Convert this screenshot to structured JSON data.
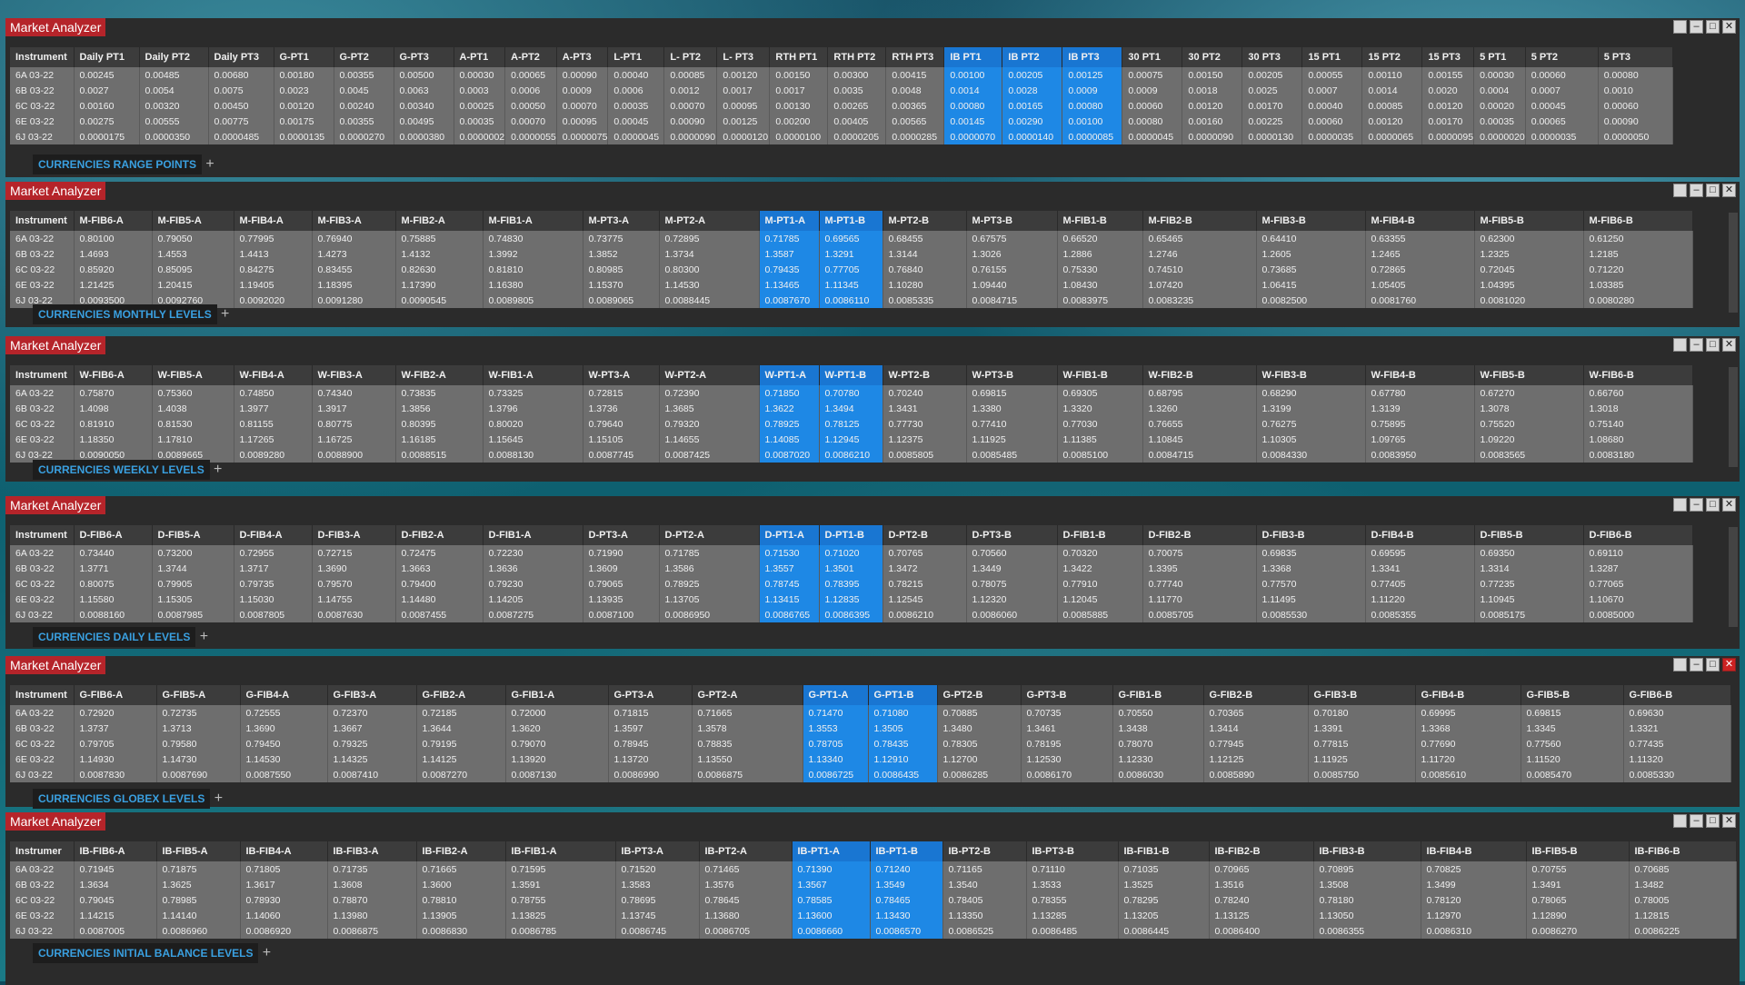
{
  "colors": {
    "title_bg": "#b5242a",
    "highlight": "#1e88e5",
    "tab_text": "#3aa0e0",
    "cell_bg": "#6e6e6e"
  },
  "panels": [
    {
      "title": "Market Analyzer",
      "tab": "CURRENCIES RANGE POINTS",
      "headers": [
        "Instrument",
        "Daily PT1",
        "Daily PT2",
        "Daily PT3",
        "G-PT1",
        "G-PT2",
        "G-PT3",
        "A-PT1",
        "A-PT2",
        "A-PT3",
        "L-PT1",
        "L- PT2",
        "L- PT3",
        "RTH PT1",
        "RTH PT2",
        "RTH PT3",
        "IB PT1",
        "IB PT2",
        "IB PT3",
        "30 PT1",
        "30 PT2",
        "30 PT3",
        "15 PT1",
        "15 PT2",
        "15 PT3",
        "5 PT1",
        "5 PT2",
        "5 PT3"
      ],
      "rows": [
        [
          "6A 03-22",
          "0.00245",
          "0.00485",
          "0.00680",
          "0.00180",
          "0.00355",
          "0.00500",
          "0.00030",
          "0.00065",
          "0.00090",
          "0.00040",
          "0.00085",
          "0.00120",
          "0.00150",
          "0.00300",
          "0.00415",
          "0.00100",
          "0.00205",
          "0.00125",
          "0.00075",
          "0.00150",
          "0.00205",
          "0.00055",
          "0.00110",
          "0.00155",
          "0.00030",
          "0.00060",
          "0.00080"
        ],
        [
          "6B 03-22",
          "0.0027",
          "0.0054",
          "0.0075",
          "0.0023",
          "0.0045",
          "0.0063",
          "0.0003",
          "0.0006",
          "0.0009",
          "0.0006",
          "0.0012",
          "0.0017",
          "0.0017",
          "0.0035",
          "0.0048",
          "0.0014",
          "0.0028",
          "0.0009",
          "0.0009",
          "0.0018",
          "0.0025",
          "0.0007",
          "0.0014",
          "0.0020",
          "0.0004",
          "0.0007",
          "0.0010"
        ],
        [
          "6C 03-22",
          "0.00160",
          "0.00320",
          "0.00450",
          "0.00120",
          "0.00240",
          "0.00340",
          "0.00025",
          "0.00050",
          "0.00070",
          "0.00035",
          "0.00070",
          "0.00095",
          "0.00130",
          "0.00265",
          "0.00365",
          "0.00080",
          "0.00165",
          "0.00080",
          "0.00060",
          "0.00120",
          "0.00170",
          "0.00040",
          "0.00085",
          "0.00120",
          "0.00020",
          "0.00045",
          "0.00060"
        ],
        [
          "6E 03-22",
          "0.00275",
          "0.00555",
          "0.00775",
          "0.00175",
          "0.00355",
          "0.00495",
          "0.00035",
          "0.00070",
          "0.00095",
          "0.00045",
          "0.00090",
          "0.00125",
          "0.00200",
          "0.00405",
          "0.00565",
          "0.00145",
          "0.00290",
          "0.00100",
          "0.00080",
          "0.00160",
          "0.00225",
          "0.00060",
          "0.00120",
          "0.00170",
          "0.00035",
          "0.00065",
          "0.00090"
        ],
        [
          "6J 03-22",
          "0.0000175",
          "0.0000350",
          "0.0000485",
          "0.0000135",
          "0.0000270",
          "0.0000380",
          "0.0000002",
          "0.0000055",
          "0.0000075",
          "0.0000045",
          "0.0000090",
          "0.0000120",
          "0.0000100",
          "0.0000205",
          "0.0000285",
          "0.0000070",
          "0.0000140",
          "0.0000085",
          "0.0000045",
          "0.0000090",
          "0.0000130",
          "0.0000035",
          "0.0000065",
          "0.0000095",
          "0.0000020",
          "0.0000035",
          "0.0000050"
        ]
      ]
    },
    {
      "title": "Market Analyzer",
      "tab": "CURRENCIES MONTHLY LEVELS",
      "headers": [
        "Instrument",
        "M-FIB6-A",
        "M-FIB5-A",
        "M-FIB4-A",
        "M-FIB3-A",
        "M-FIB2-A",
        "M-FIB1-A",
        "M-PT3-A",
        "M-PT2-A",
        "M-PT1-A",
        "M-PT1-B",
        "M-PT2-B",
        "M-PT3-B",
        "M-FIB1-B",
        "M-FIB2-B",
        "M-FIB3-B",
        "M-FIB4-B",
        "M-FIB5-B",
        "M-FIB6-B"
      ],
      "rows": [
        [
          "6A 03-22",
          "0.80100",
          "0.79050",
          "0.77995",
          "0.76940",
          "0.75885",
          "0.74830",
          "0.73775",
          "0.72895",
          "0.71785",
          "0.69565",
          "0.68455",
          "0.67575",
          "0.66520",
          "0.65465",
          "0.64410",
          "0.63355",
          "0.62300",
          "0.61250"
        ],
        [
          "6B 03-22",
          "1.4693",
          "1.4553",
          "1.4413",
          "1.4273",
          "1.4132",
          "1.3992",
          "1.3852",
          "1.3734",
          "1.3587",
          "1.3291",
          "1.3144",
          "1.3026",
          "1.2886",
          "1.2746",
          "1.2605",
          "1.2465",
          "1.2325",
          "1.2185"
        ],
        [
          "6C 03-22",
          "0.85920",
          "0.85095",
          "0.84275",
          "0.83455",
          "0.82630",
          "0.81810",
          "0.80985",
          "0.80300",
          "0.79435",
          "0.77705",
          "0.76840",
          "0.76155",
          "0.75330",
          "0.74510",
          "0.73685",
          "0.72865",
          "0.72045",
          "0.71220"
        ],
        [
          "6E 03-22",
          "1.21425",
          "1.20415",
          "1.19405",
          "1.18395",
          "1.17390",
          "1.16380",
          "1.15370",
          "1.14530",
          "1.13465",
          "1.11345",
          "1.10280",
          "1.09440",
          "1.08430",
          "1.07420",
          "1.06415",
          "1.05405",
          "1.04395",
          "1.03385"
        ],
        [
          "6J 03-22",
          "0.0093500",
          "0.0092760",
          "0.0092020",
          "0.0091280",
          "0.0090545",
          "0.0089805",
          "0.0089065",
          "0.0088445",
          "0.0087670",
          "0.0086110",
          "0.0085335",
          "0.0084715",
          "0.0083975",
          "0.0083235",
          "0.0082500",
          "0.0081760",
          "0.0081020",
          "0.0080280"
        ]
      ]
    },
    {
      "title": "Market Analyzer",
      "tab": "CURRENCIES WEEKLY LEVELS",
      "headers": [
        "Instrument",
        "W-FIB6-A",
        "W-FIB5-A",
        "W-FIB4-A",
        "W-FIB3-A",
        "W-FIB2-A",
        "W-FIB1-A",
        "W-PT3-A",
        "W-PT2-A",
        "W-PT1-A",
        "W-PT1-B",
        "W-PT2-B",
        "W-PT3-B",
        "W-FIB1-B",
        "W-FIB2-B",
        "W-FIB3-B",
        "W-FIB4-B",
        "W-FIB5-B",
        "W-FIB6-B"
      ],
      "rows": [
        [
          "6A 03-22",
          "0.75870",
          "0.75360",
          "0.74850",
          "0.74340",
          "0.73835",
          "0.73325",
          "0.72815",
          "0.72390",
          "0.71850",
          "0.70780",
          "0.70240",
          "0.69815",
          "0.69305",
          "0.68795",
          "0.68290",
          "0.67780",
          "0.67270",
          "0.66760"
        ],
        [
          "6B 03-22",
          "1.4098",
          "1.4038",
          "1.3977",
          "1.3917",
          "1.3856",
          "1.3796",
          "1.3736",
          "1.3685",
          "1.3622",
          "1.3494",
          "1.3431",
          "1.3380",
          "1.3320",
          "1.3260",
          "1.3199",
          "1.3139",
          "1.3078",
          "1.3018"
        ],
        [
          "6C 03-22",
          "0.81910",
          "0.81530",
          "0.81155",
          "0.80775",
          "0.80395",
          "0.80020",
          "0.79640",
          "0.79320",
          "0.78925",
          "0.78125",
          "0.77730",
          "0.77410",
          "0.77030",
          "0.76655",
          "0.76275",
          "0.75895",
          "0.75520",
          "0.75140"
        ],
        [
          "6E 03-22",
          "1.18350",
          "1.17810",
          "1.17265",
          "1.16725",
          "1.16185",
          "1.15645",
          "1.15105",
          "1.14655",
          "1.14085",
          "1.12945",
          "1.12375",
          "1.11925",
          "1.11385",
          "1.10845",
          "1.10305",
          "1.09765",
          "1.09220",
          "1.08680"
        ],
        [
          "6J 03-22",
          "0.0090050",
          "0.0089665",
          "0.0089280",
          "0.0088900",
          "0.0088515",
          "0.0088130",
          "0.0087745",
          "0.0087425",
          "0.0087020",
          "0.0086210",
          "0.0085805",
          "0.0085485",
          "0.0085100",
          "0.0084715",
          "0.0084330",
          "0.0083950",
          "0.0083565",
          "0.0083180"
        ]
      ]
    },
    {
      "title": "Market Analyzer",
      "tab": "CURRENCIES DAILY LEVELS",
      "headers": [
        "Instrument",
        "D-FIB6-A",
        "D-FIB5-A",
        "D-FIB4-A",
        "D-FIB3-A",
        "D-FIB2-A",
        "D-FIB1-A",
        "D-PT3-A",
        "D-PT2-A",
        "D-PT1-A",
        "D-PT1-B",
        "D-PT2-B",
        "D-PT3-B",
        "D-FIB1-B",
        "D-FIB2-B",
        "D-FIB3-B",
        "D-FIB4-B",
        "D-FIB5-B",
        "D-FIB6-B"
      ],
      "rows": [
        [
          "6A 03-22",
          "0.73440",
          "0.73200",
          "0.72955",
          "0.72715",
          "0.72475",
          "0.72230",
          "0.71990",
          "0.71785",
          "0.71530",
          "0.71020",
          "0.70765",
          "0.70560",
          "0.70320",
          "0.70075",
          "0.69835",
          "0.69595",
          "0.69350",
          "0.69110"
        ],
        [
          "6B 03-22",
          "1.3771",
          "1.3744",
          "1.3717",
          "1.3690",
          "1.3663",
          "1.3636",
          "1.3609",
          "1.3586",
          "1.3557",
          "1.3501",
          "1.3472",
          "1.3449",
          "1.3422",
          "1.3395",
          "1.3368",
          "1.3341",
          "1.3314",
          "1.3287"
        ],
        [
          "6C 03-22",
          "0.80075",
          "0.79905",
          "0.79735",
          "0.79570",
          "0.79400",
          "0.79230",
          "0.79065",
          "0.78925",
          "0.78745",
          "0.78395",
          "0.78215",
          "0.78075",
          "0.77910",
          "0.77740",
          "0.77570",
          "0.77405",
          "0.77235",
          "0.77065"
        ],
        [
          "6E 03-22",
          "1.15580",
          "1.15305",
          "1.15030",
          "1.14755",
          "1.14480",
          "1.14205",
          "1.13935",
          "1.13705",
          "1.13415",
          "1.12835",
          "1.12545",
          "1.12320",
          "1.12045",
          "1.11770",
          "1.11495",
          "1.11220",
          "1.10945",
          "1.10670"
        ],
        [
          "6J 03-22",
          "0.0088160",
          "0.0087985",
          "0.0087805",
          "0.0087630",
          "0.0087455",
          "0.0087275",
          "0.0087100",
          "0.0086950",
          "0.0086765",
          "0.0086395",
          "0.0086210",
          "0.0086060",
          "0.0085885",
          "0.0085705",
          "0.0085530",
          "0.0085355",
          "0.0085175",
          "0.0085000"
        ]
      ]
    },
    {
      "title": "Market Analyzer",
      "tab": "CURRENCIES GLOBEX LEVELS",
      "headers": [
        "Instrument",
        "G-FIB6-A",
        "G-FIB5-A",
        "G-FIB4-A",
        "G-FIB3-A",
        "G-FIB2-A",
        "G-FIB1-A",
        "G-PT3-A",
        "G-PT2-A",
        "G-PT1-A",
        "G-PT1-B",
        "G-PT2-B",
        "G-PT3-B",
        "G-FIB1-B",
        "G-FIB2-B",
        "G-FIB3-B",
        "G-FIB4-B",
        "G-FIB5-B",
        "G-FIB6-B"
      ],
      "rows": [
        [
          "6A 03-22",
          "0.72920",
          "0.72735",
          "0.72555",
          "0.72370",
          "0.72185",
          "0.72000",
          "0.71815",
          "0.71665",
          "0.71470",
          "0.71080",
          "0.70885",
          "0.70735",
          "0.70550",
          "0.70365",
          "0.70180",
          "0.69995",
          "0.69815",
          "0.69630"
        ],
        [
          "6B 03-22",
          "1.3737",
          "1.3713",
          "1.3690",
          "1.3667",
          "1.3644",
          "1.3620",
          "1.3597",
          "1.3578",
          "1.3553",
          "1.3505",
          "1.3480",
          "1.3461",
          "1.3438",
          "1.3414",
          "1.3391",
          "1.3368",
          "1.3345",
          "1.3321"
        ],
        [
          "6C 03-22",
          "0.79705",
          "0.79580",
          "0.79450",
          "0.79325",
          "0.79195",
          "0.79070",
          "0.78945",
          "0.78835",
          "0.78705",
          "0.78435",
          "0.78305",
          "0.78195",
          "0.78070",
          "0.77945",
          "0.77815",
          "0.77690",
          "0.77560",
          "0.77435"
        ],
        [
          "6E 03-22",
          "1.14930",
          "1.14730",
          "1.14530",
          "1.14325",
          "1.14125",
          "1.13920",
          "1.13720",
          "1.13550",
          "1.13340",
          "1.12910",
          "1.12700",
          "1.12530",
          "1.12330",
          "1.12125",
          "1.11925",
          "1.11720",
          "1.11520",
          "1.11320"
        ],
        [
          "6J 03-22",
          "0.0087830",
          "0.0087690",
          "0.0087550",
          "0.0087410",
          "0.0087270",
          "0.0087130",
          "0.0086990",
          "0.0086875",
          "0.0086725",
          "0.0086435",
          "0.0086285",
          "0.0086170",
          "0.0086030",
          "0.0085890",
          "0.0085750",
          "0.0085610",
          "0.0085470",
          "0.0085330"
        ]
      ]
    },
    {
      "title": "Market Analyzer",
      "tab": "CURRENCIES INITIAL BALANCE LEVELS",
      "headers": [
        "Instrumer",
        "IB-FIB6-A",
        "IB-FIB5-A",
        "IB-FIB4-A",
        "IB-FIB3-A",
        "IB-FIB2-A",
        "IB-FIB1-A",
        "IB-PT3-A",
        "IB-PT2-A",
        "IB-PT1-A",
        "IB-PT1-B",
        "IB-PT2-B",
        "IB-PT3-B",
        "IB-FIB1-B",
        "IB-FIB2-B",
        "IB-FIB3-B",
        "IB-FIB4-B",
        "IB-FIB5-B",
        "IB-FIB6-B"
      ],
      "rows": [
        [
          "6A 03-22",
          "0.71945",
          "0.71875",
          "0.71805",
          "0.71735",
          "0.71665",
          "0.71595",
          "0.71520",
          "0.71465",
          "0.71390",
          "0.71240",
          "0.71165",
          "0.71110",
          "0.71035",
          "0.70965",
          "0.70895",
          "0.70825",
          "0.70755",
          "0.70685"
        ],
        [
          "6B 03-22",
          "1.3634",
          "1.3625",
          "1.3617",
          "1.3608",
          "1.3600",
          "1.3591",
          "1.3583",
          "1.3576",
          "1.3567",
          "1.3549",
          "1.3540",
          "1.3533",
          "1.3525",
          "1.3516",
          "1.3508",
          "1.3499",
          "1.3491",
          "1.3482"
        ],
        [
          "6C 03-22",
          "0.79045",
          "0.78985",
          "0.78930",
          "0.78870",
          "0.78810",
          "0.78755",
          "0.78695",
          "0.78645",
          "0.78585",
          "0.78465",
          "0.78405",
          "0.78355",
          "0.78295",
          "0.78240",
          "0.78180",
          "0.78120",
          "0.78065",
          "0.78005"
        ],
        [
          "6E 03-22",
          "1.14215",
          "1.14140",
          "1.14060",
          "1.13980",
          "1.13905",
          "1.13825",
          "1.13745",
          "1.13680",
          "1.13600",
          "1.13430",
          "1.13350",
          "1.13285",
          "1.13205",
          "1.13125",
          "1.13050",
          "1.12970",
          "1.12890",
          "1.12815"
        ],
        [
          "6J 03-22",
          "0.0087005",
          "0.0086960",
          "0.0086920",
          "0.0086875",
          "0.0086830",
          "0.0086785",
          "0.0086745",
          "0.0086705",
          "0.0086660",
          "0.0086570",
          "0.0086525",
          "0.0086485",
          "0.0086445",
          "0.0086400",
          "0.0086355",
          "0.0086310",
          "0.0086270",
          "0.0086225"
        ]
      ]
    }
  ]
}
